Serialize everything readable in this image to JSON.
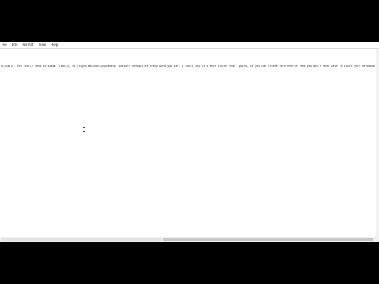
{
  "menu": {
    "items": [
      {
        "label": "File"
      },
      {
        "label": "Edit"
      },
      {
        "label": "Format"
      },
      {
        "label": "View"
      },
      {
        "label": "Help"
      }
    ]
  },
  "document": {
    "text": "writable. You really need to speak clearly, so Dragon NaturallySpeaking software recognizes every word you say. I would say it's much faster than typing, so you can create more entries and you don't even have to touch your keyboard!"
  },
  "icons": {
    "cursor": "ibeam-cursor-icon"
  }
}
